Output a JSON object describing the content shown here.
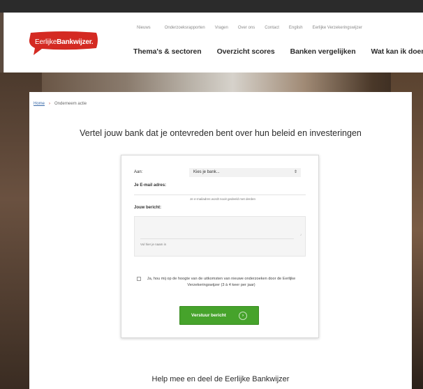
{
  "header": {
    "logo": {
      "prefix": "Eerlijke",
      "name": "Bankwijzer."
    },
    "utility_nav": [
      "Nieuws",
      "Onderzoeksrapporten",
      "Vragen",
      "Over ons",
      "Contact",
      "English",
      "Eerlijke Verzekeringswijzer"
    ],
    "main_nav": [
      "Thema's & sectoren",
      "Overzicht scores",
      "Banken vergelijken",
      "Wat kan ik doen?"
    ]
  },
  "breadcrumb": {
    "home": "Home",
    "separator": "›",
    "current": "Onderneem actie"
  },
  "headline": "Vertel jouw bank dat je ontevreden bent over hun beleid en investeringen",
  "form": {
    "to_label": "Aan:",
    "bank_select_value": "Kies je bank...",
    "select_arrow": "⇕",
    "email_label": "Je E-mail adres:",
    "email_hint": "Je e-mailadres wordt nooit gedeeld met derden",
    "message_label": "Jouw bericht:",
    "message_hint": "Vul hier je naam in",
    "checkbox_text": "Ja, hou mij op de hoogte van de uitkomsten van nieuwe onderzoeken door de Eerlijke Verzekeringswijzer (3 à 4 keer per jaar)",
    "submit_label": "Verstuur bericht",
    "submit_arrow": "›"
  },
  "help_heading": "Help mee en deel de Eerlijke Bankwijzer",
  "colors": {
    "brand_red": "#d42a22",
    "submit_green": "#46a32b"
  },
  "icons": {
    "logo": "speech-bubble-logo",
    "select_arrow": "updown-arrow-icon",
    "submit_arrow": "chevron-right-icon"
  }
}
